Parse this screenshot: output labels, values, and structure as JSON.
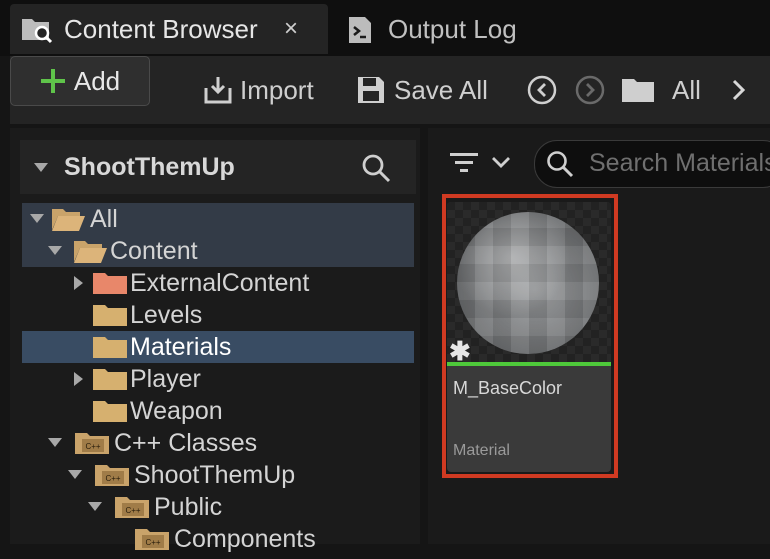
{
  "tabs": [
    {
      "label": "Content Browser",
      "icon": "folder-search-icon",
      "active": true,
      "close_glyph": "×"
    },
    {
      "label": "Output Log",
      "icon": "terminal-icon",
      "active": false
    }
  ],
  "toolbar": {
    "add_label": "Add",
    "import_label": "Import",
    "save_all_label": "Save All",
    "path_label": "All",
    "accent": "#5fc44a"
  },
  "sources": {
    "title": "ShootThemUp",
    "items": [
      {
        "label": "All",
        "icon": "folder-open-icon",
        "expanded": true
      },
      {
        "label": "Content",
        "icon": "folder-open-icon",
        "expanded": true
      },
      {
        "label": "ExternalContent",
        "icon": "folder-icon",
        "color": "#e8876a"
      },
      {
        "label": "Levels",
        "icon": "folder-icon"
      },
      {
        "label": "Materials",
        "icon": "folder-icon",
        "selected": true
      },
      {
        "label": "Player",
        "icon": "folder-icon"
      },
      {
        "label": "Weapon",
        "icon": "folder-icon"
      },
      {
        "label": "C++ Classes",
        "icon": "cpp-folder-icon",
        "expanded": true
      },
      {
        "label": "ShootThemUp",
        "icon": "cpp-folder-icon",
        "expanded": true
      },
      {
        "label": "Public",
        "icon": "cpp-folder-icon",
        "expanded": true
      },
      {
        "label": "Components",
        "icon": "cpp-folder-icon"
      }
    ]
  },
  "search": {
    "placeholder": "Search Materials"
  },
  "asset": {
    "name": "M_BaseColor",
    "type": "Material",
    "type_color": "#4ec93a",
    "highlight_color": "#d03a22"
  }
}
